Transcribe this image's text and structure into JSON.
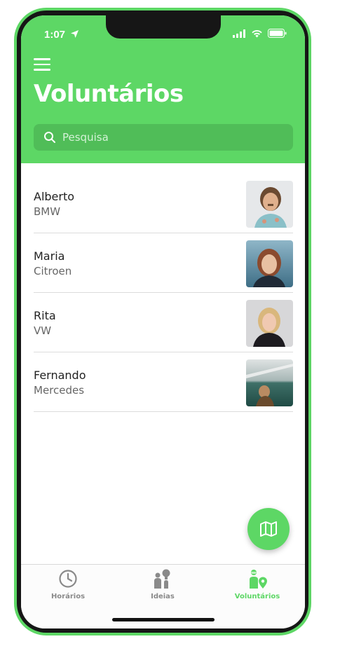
{
  "status_bar": {
    "time": "1:07"
  },
  "header": {
    "title": "Voluntários",
    "search": {
      "placeholder": "Pesquisa",
      "value": ""
    }
  },
  "volunteers": [
    {
      "name": "Alberto",
      "car": "BMW"
    },
    {
      "name": "Maria",
      "car": "Citroen"
    },
    {
      "name": "Rita",
      "car": "VW"
    },
    {
      "name": "Fernando",
      "car": "Mercedes"
    }
  ],
  "tabs": [
    {
      "label": "Horários",
      "icon": "clock-icon",
      "active": false
    },
    {
      "label": "Ideias",
      "icon": "people-ideas-icon",
      "active": false
    },
    {
      "label": "Voluntários",
      "icon": "volunteer-location-icon",
      "active": true
    }
  ],
  "colors": {
    "accent": "#5dd765",
    "search_bg": "#50bd58",
    "tab_inactive": "#8a8a8a",
    "tab_active": "#5dd765"
  }
}
